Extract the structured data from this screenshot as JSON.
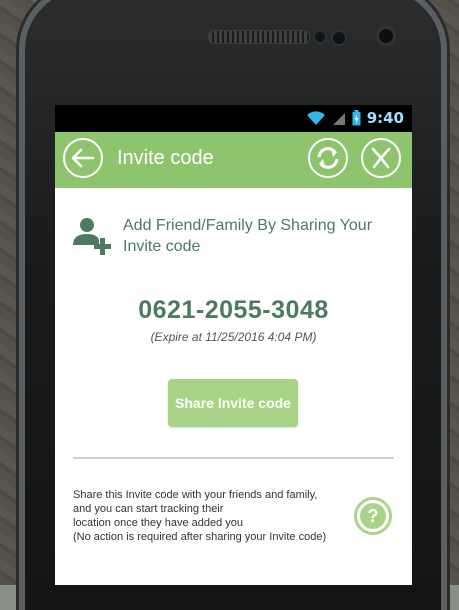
{
  "status_bar": {
    "time": "9:40"
  },
  "app_bar": {
    "title": "Invite code",
    "back_icon": "back-arrow-icon",
    "refresh_icon": "refresh-icon",
    "sms_icon": "sms-icon"
  },
  "invite": {
    "heading": "Add Friend/Family By Sharing Your Invite code",
    "code": "0621-2055-3048",
    "expire_text": "(Expire at 11/25/2016 4:04 PM)",
    "share_label": "Share Invite code"
  },
  "info": {
    "line1": "Share this Invite code with your friends and family,",
    "line2": "and you can start tracking their",
    "line3": "location once they have added you",
    "line4": "(No action is required after sharing your Invite code)",
    "help_label": "?"
  },
  "colors": {
    "accent": "#8fc46e",
    "button": "#a9d487",
    "text_green": "#4c7b62"
  }
}
